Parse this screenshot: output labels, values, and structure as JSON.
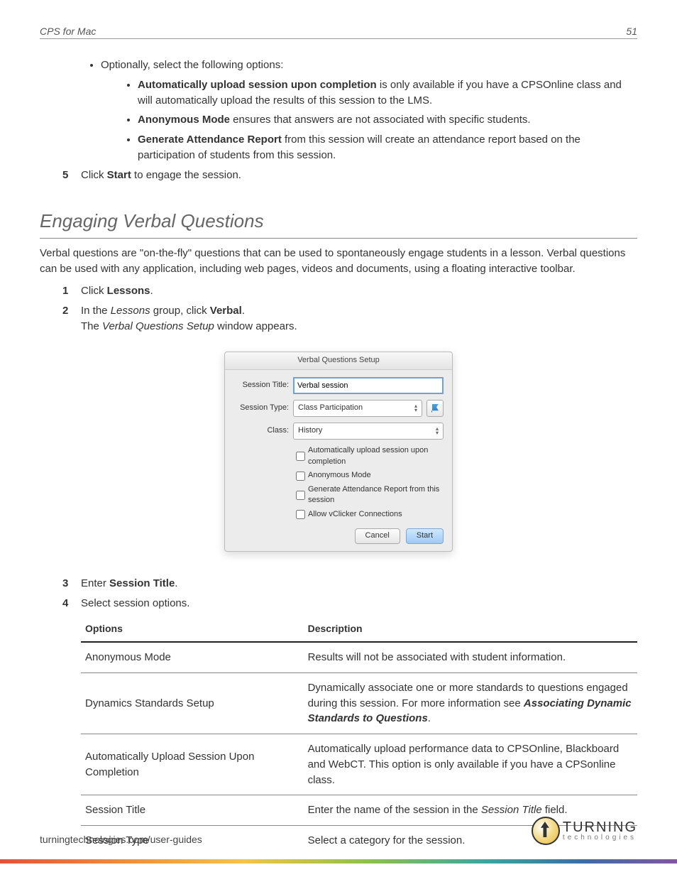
{
  "header": {
    "left": "CPS for Mac",
    "right": "51"
  },
  "intro": {
    "opt_lead": "Optionally, select the following options:",
    "opt1_b": "Automatically upload session upon completion",
    "opt1_t": " is only available if you have a CPSOnline class and will automatically upload the results of this session to the LMS.",
    "opt2_b": "Anonymous Mode",
    "opt2_t": " ensures that answers are not associated with specific students.",
    "opt3_b": "Generate Attendance Report",
    "opt3_t": " from this session will create an attendance report based on the participation of students from this session.",
    "step5_num": "5",
    "step5_a": "Click ",
    "step5_b": "Start",
    "step5_c": " to engage the session."
  },
  "h2": "Engaging Verbal Questions",
  "verbal_intro": "Verbal questions are \"on-the-fly\" questions that can be used to spontaneously engage students in a lesson. Verbal questions can be used with any application, including web pages, videos and documents, using a floating interactive toolbar.",
  "steps": {
    "n1": "1",
    "s1a": "Click ",
    "s1b": "Lessons",
    "s1c": ".",
    "n2": "2",
    "s2a": "In the ",
    "s2i": "Lessons",
    "s2b": " group, click ",
    "s2c": "Verbal",
    "s2d": ".",
    "s2_sub_a": "The ",
    "s2_sub_i": "Verbal Questions Setup",
    "s2_sub_b": " window appears.",
    "n3": "3",
    "s3a": "Enter ",
    "s3b": "Session Title",
    "s3c": ".",
    "n4": "4",
    "s4": "Select session options."
  },
  "dialog": {
    "title": "Verbal Questions Setup",
    "l_title": "Session Title:",
    "v_title": "Verbal session",
    "l_type": "Session Type:",
    "v_type": "Class Participation",
    "l_class": "Class:",
    "v_class": "History",
    "c1": "Automatically upload session upon completion",
    "c2": "Anonymous Mode",
    "c3": "Generate Attendance Report from this session",
    "c4": "Allow vClicker Connections",
    "cancel": "Cancel",
    "start": "Start"
  },
  "table": {
    "h1": "Options",
    "h2": "Description",
    "r1o": "Anonymous Mode",
    "r1d": "Results will not be associated with student information.",
    "r2o": "Dynamics Standards Setup",
    "r2d_a": "Dynamically associate one or more standards to questions engaged during this session. For more information see ",
    "r2d_b": "Associating Dynamic Standards to Questions",
    "r2d_c": ".",
    "r3o": "Automatically Upload Session Upon Completion",
    "r3d": "Automatically upload performance data to CPSOnline, Blackboard and WebCT. This option is only available if you have a CPSonline class.",
    "r4o": "Session Title",
    "r4d_a": "Enter the name of the session in the ",
    "r4d_i": "Session Title",
    "r4d_b": " field.",
    "r5o": "Session Type",
    "r5d": "Select a category for the session."
  },
  "footer": {
    "url": "turningtechnologies.com/user-guides",
    "logo1": "TURNING",
    "logo2": "technologies"
  }
}
